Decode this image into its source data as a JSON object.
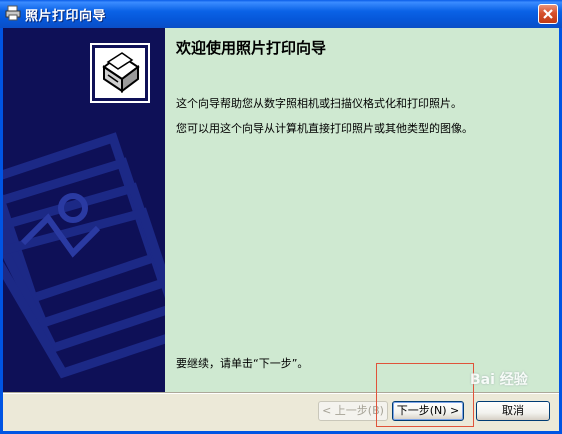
{
  "window": {
    "title": "照片打印向导",
    "colors": {
      "titlebar": "#0a5ce8",
      "sidebar": "#0e1057",
      "content": "#cfe9d1",
      "close": "#d6512d"
    }
  },
  "icons": {
    "app": "printer-icon",
    "close": "close-icon",
    "wizard": "photo-printer-icon"
  },
  "content": {
    "heading": "欢迎使用照片打印向导",
    "paragraph1": "这个向导帮助您从数字照相机或扫描仪格式化和打印照片。",
    "paragraph2": "您可以用这个向导从计算机直接打印照片或其他类型的图像。",
    "continue_text": "要继续，请单击“下一步”。"
  },
  "buttons": {
    "back": "< 上一步(B)",
    "next": "下一步(N) >",
    "cancel": "取消"
  },
  "watermark": "Bai 经验"
}
